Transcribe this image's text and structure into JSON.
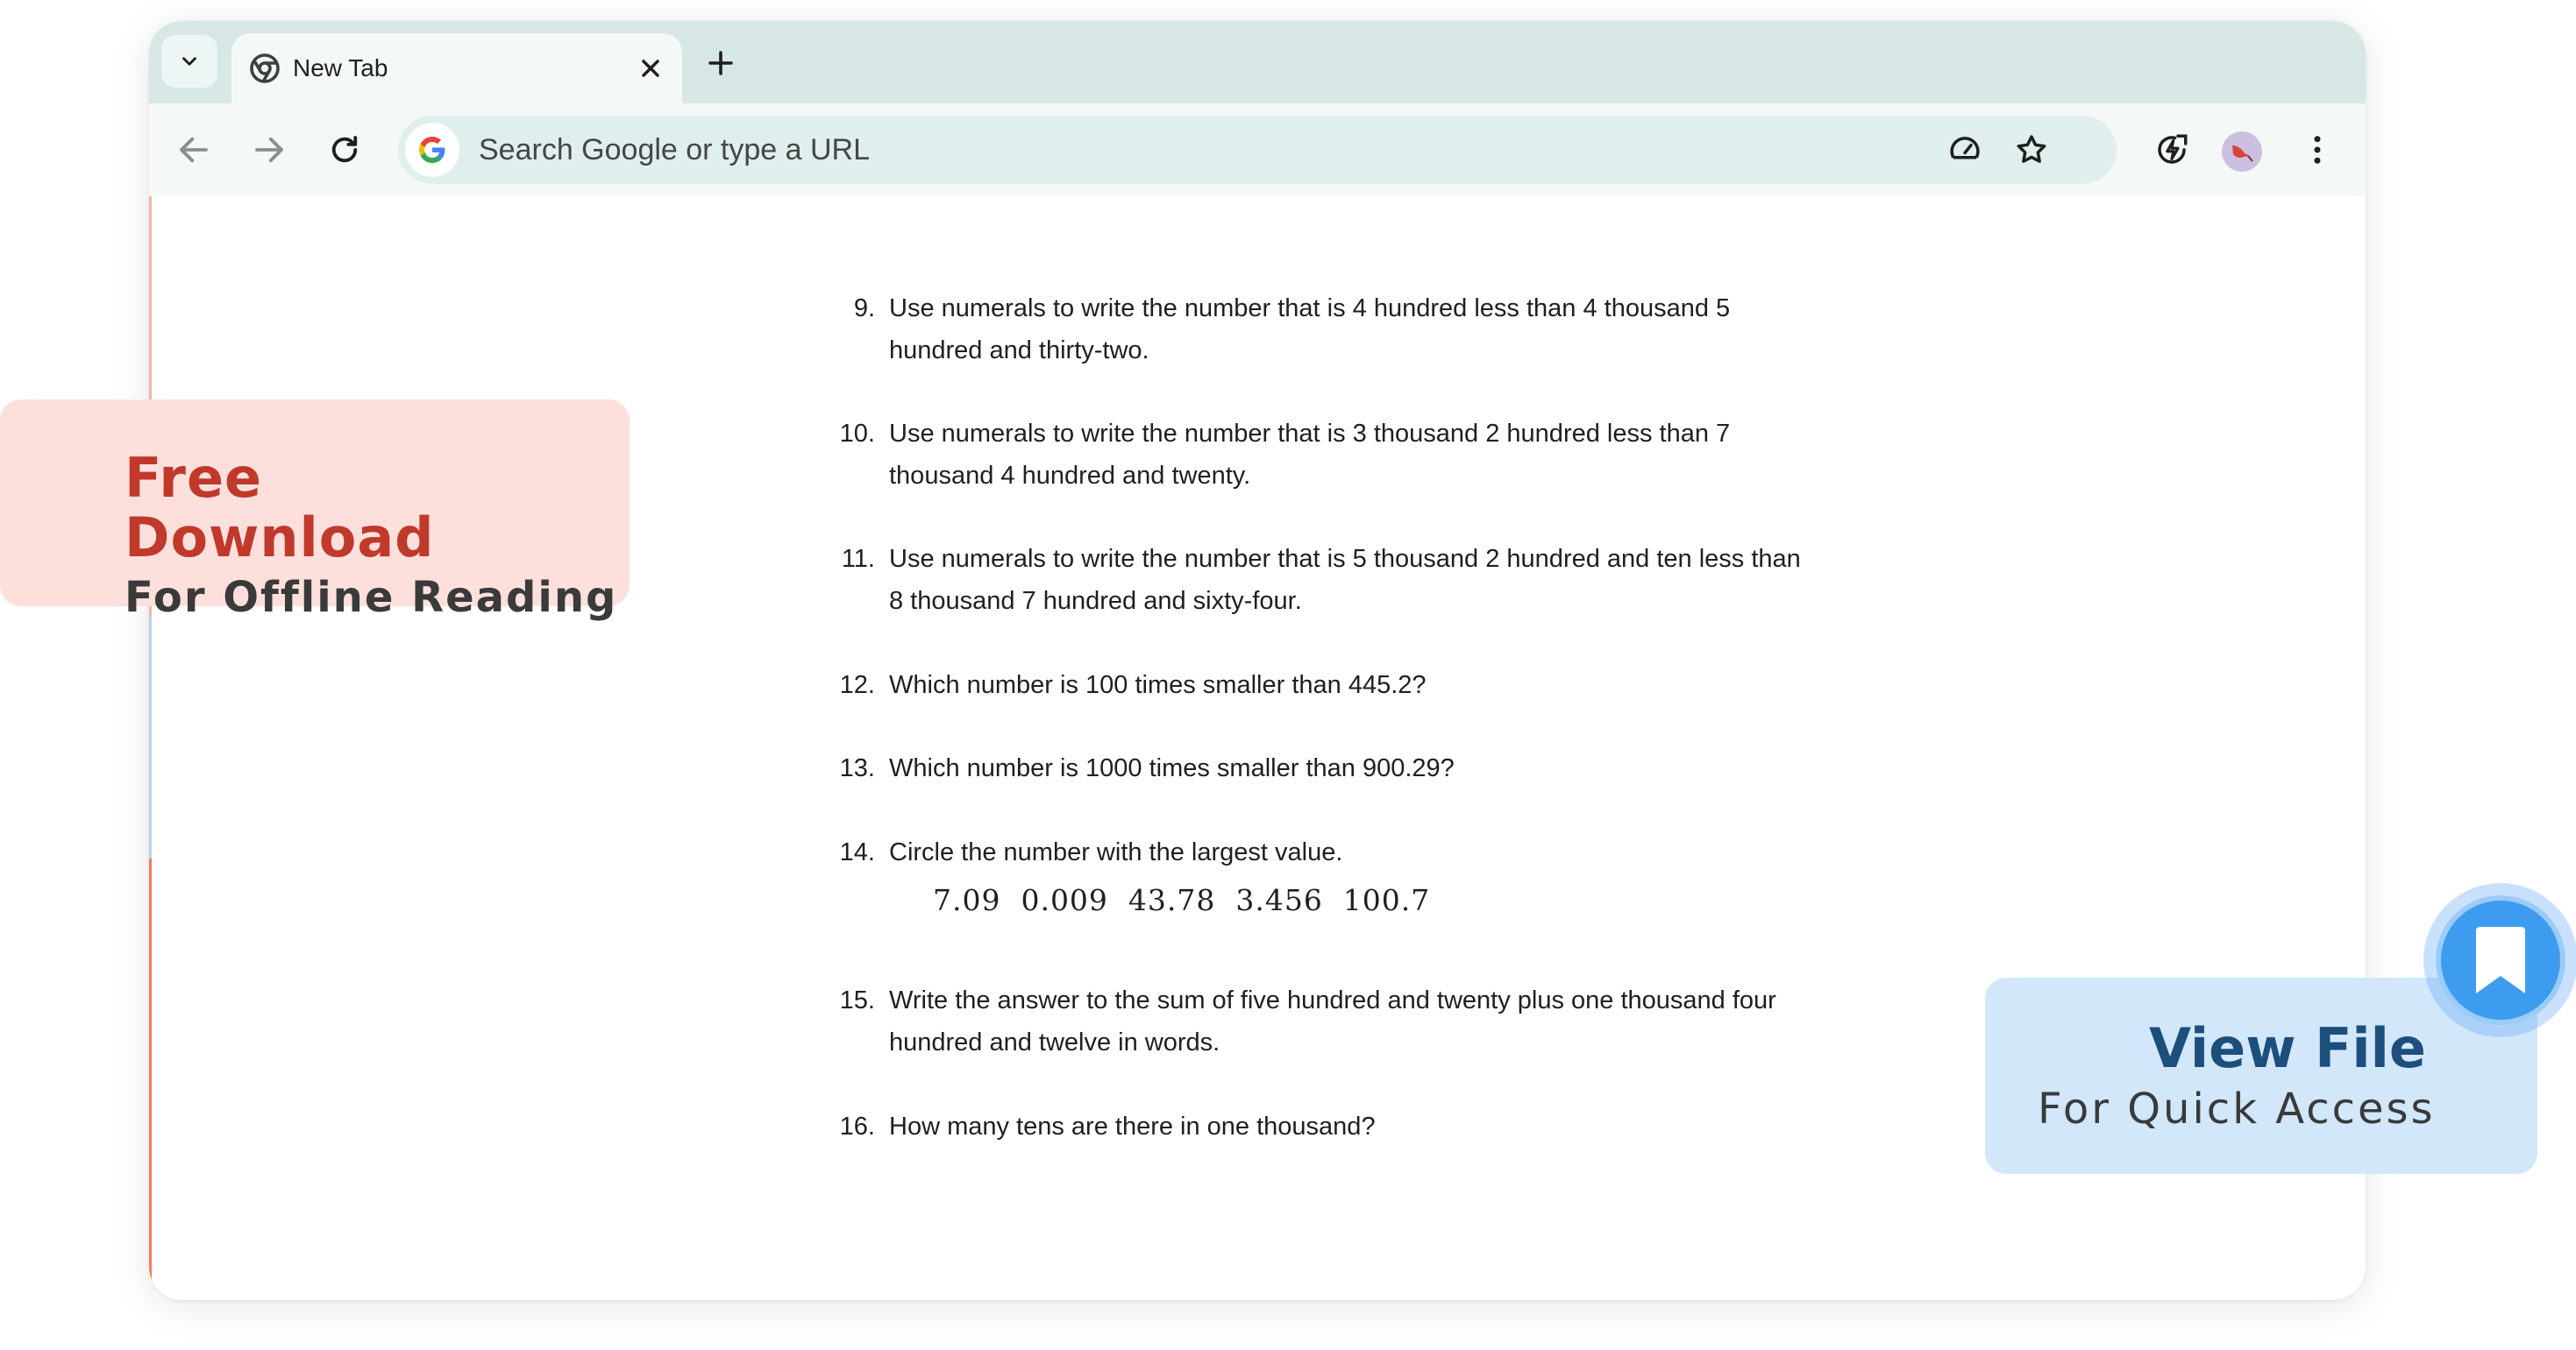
{
  "browser": {
    "tab": {
      "title": "New Tab"
    },
    "omnibox": {
      "placeholder": "Search Google or type a URL"
    }
  },
  "questions": [
    {
      "num": "9.",
      "text": "Use numerals to write the number that is 4 hundred less than 4 thousand 5 hundred and thirty-two."
    },
    {
      "num": "10.",
      "text": "Use numerals to write the number that is 3 thousand 2 hundred less than 7 thousand 4 hundred and twenty."
    },
    {
      "num": "11.",
      "text": "Use numerals to write the number that is 5 thousand 2 hundred and ten less than 8 thousand 7 hundred and sixty-four."
    },
    {
      "num": "12.",
      "text": "Which number is 100 times smaller than 445.2?"
    },
    {
      "num": "13.",
      "text": "Which number is 1000 times smaller than 900.29?"
    },
    {
      "num": "14.",
      "text": "Circle the number with the largest value.",
      "values": "7.09  0.009  43.78  3.456  100.7"
    },
    {
      "num": "15.",
      "text": "Write the answer to the sum of five hundred and twenty plus one thousand four hundred and twelve in words."
    },
    {
      "num": "16.",
      "text": "How many tens are there in one thousand?"
    }
  ],
  "promo_left": {
    "line1": "Free",
    "line2": "Download",
    "line3": "For Offline Reading"
  },
  "promo_right": {
    "line1": "View File",
    "line2": "For Quick Access"
  },
  "colors": {
    "tabstrip": "#d6e7e6",
    "toolbar": "#f4f9f8",
    "promo_left_bg": "#fde0dc",
    "promo_left_accent": "#c0392b",
    "promo_right_bg": "#d3e7fb",
    "promo_right_accent": "#1d4f7c",
    "bookmark_button": "#3d9cf0"
  },
  "icons": [
    "chevron-down-icon",
    "chrome-icon",
    "close-icon",
    "plus-icon",
    "back-icon",
    "forward-icon",
    "reload-icon",
    "google-icon",
    "performance-icon",
    "star-icon",
    "energy-saver-icon",
    "profile-avatar",
    "more-vert-icon",
    "bookmark-icon"
  ]
}
